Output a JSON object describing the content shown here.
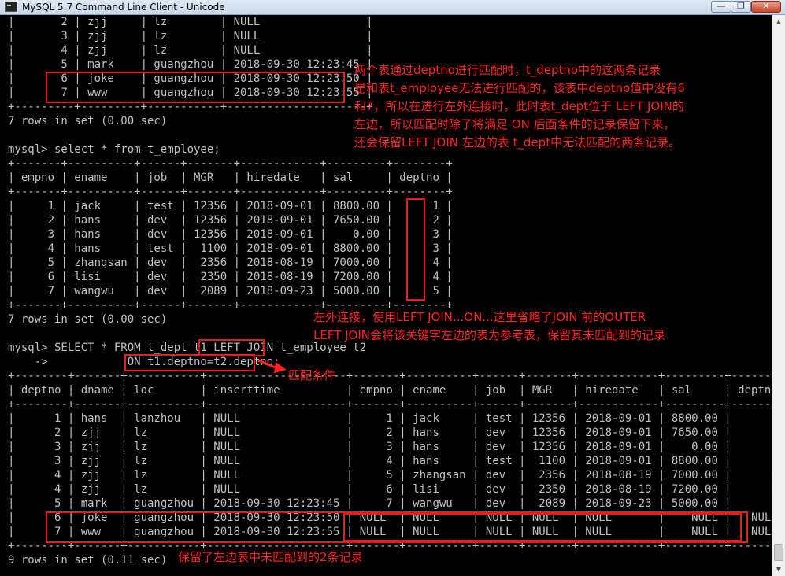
{
  "window": {
    "title": "MySQL 5.7 Command Line Client - Unicode",
    "icon": "console-icon"
  },
  "console": {
    "lines": [
      "|       2 | zjj     | lz        | NULL                |",
      "|       3 | zjj     | lz        | NULL                |",
      "|       4 | zjj     | lz        | NULL                |",
      "|       5 | mark    | guangzhou | 2018-09-30 12:23:45 |",
      "|       6 | joke    | guangzhou | 2018-09-30 12:23:50 |",
      "|       7 | www     | guangzhou | 2018-09-30 12:23:55 |",
      "+---------+---------+-----------+---------------------+",
      "7 rows in set (0.00 sec)",
      "",
      "mysql> select * from t_employee;",
      "+-------+----------+------+-------+------------+---------+--------+",
      "| empno | ename    | job  | MGR   | hiredate   | sal     | deptno |",
      "+-------+----------+------+-------+------------+---------+--------+",
      "|     1 | jack     | test | 12356 | 2018-09-01 | 8800.00 |      1 |",
      "|     2 | hans     | dev  | 12356 | 2018-09-01 | 7650.00 |      2 |",
      "|     3 | hans     | dev  | 12356 | 2018-09-01 |    0.00 |      3 |",
      "|     4 | hans     | test |  1100 | 2018-09-01 | 8800.00 |      3 |",
      "|     5 | zhangsan | dev  |  2356 | 2018-08-19 | 7000.00 |      4 |",
      "|     6 | lisi     | dev  |  2350 | 2018-08-19 | 7200.00 |      4 |",
      "|     7 | wangwu   | dev  |  2089 | 2018-09-23 | 5000.00 |      5 |",
      "+-------+----------+------+-------+------------+---------+--------+",
      "7 rows in set (0.00 sec)",
      "",
      "mysql> SELECT * FROM t_dept t1 LEFT JOIN t_employee t2",
      "    ->            ON t1.deptno=t2.deptno;",
      "+--------+-------+-----------+---------------------+-------+----------+------+-------+------------+---------+--------+",
      "| deptno | dname | loc       | inserttime          | empno | ename    | job  | MGR   | hiredate   | sal     | deptno |",
      "+--------+-------+-----------+---------------------+-------+----------+------+-------+------------+---------+--------+",
      "|      1 | hans  | lanzhou   | NULL                |     1 | jack     | test | 12356 | 2018-09-01 | 8800.00 |      1 |",
      "|      2 | zjj   | lz        | NULL                |     2 | hans     | dev  | 12356 | 2018-09-01 | 7650.00 |      2 |",
      "|      3 | zjj   | lz        | NULL                |     3 | hans     | dev  | 12356 | 2018-09-01 |    0.00 |      3 |",
      "|      3 | zjj   | lz        | NULL                |     4 | hans     | test |  1100 | 2018-09-01 | 8800.00 |      3 |",
      "|      4 | zjj   | lz        | NULL                |     5 | zhangsan | dev  |  2356 | 2018-08-19 | 7000.00 |      4 |",
      "|      4 | zjj   | lz        | NULL                |     6 | lisi     | dev  |  2350 | 2018-08-19 | 7200.00 |      4 |",
      "|      5 | mark  | guangzhou | 2018-09-30 12:23:45 |     7 | wangwu   | dev  |  2089 | 2018-09-23 | 5000.00 |      5 |",
      "|      6 | joke  | guangzhou | 2018-09-30 12:23:50 | NULL  | NULL     | NULL | NULL  | NULL       |    NULL |   NULL |",
      "|      7 | www   | guangzhou | 2018-09-30 12:23:55 | NULL  | NULL     | NULL | NULL  | NULL       |    NULL |   NULL |",
      "+--------+-------+-----------+---------------------+-------+----------+------+-------+------------+---------+--------+",
      "9 rows in set (0.11 sec)"
    ]
  },
  "annotations": {
    "top_note": "两个表通过deptno进行匹配时，t_deptno中的这两条记录\n是和表t_employee无法进行匹配的，该表中deptno值中没有6\n和7，所以在进行左外连接时，此时表t_dept位于 LEFT JOIN的\n左边，所以匹配时除了将满足 ON 后面条件的记录保留下来，\n还会保留LEFT JOIN 左边的表 t_dept中无法匹配的两条记录。",
    "middle_note": "左外连接，使用LEFT JOIN...ON...这里省略了JOIN 前的OUTER\nLEFT JOIN会将该关键字左边的表为参考表，保留其未匹配到的记录",
    "condition_note": "匹配条件",
    "bottom_note": "保留了左边表中未匹配到的2条记录"
  },
  "colors": {
    "terminal_bg": "#000000",
    "terminal_fg": "#c0c0c0",
    "annotation_red": "#ff2424"
  }
}
